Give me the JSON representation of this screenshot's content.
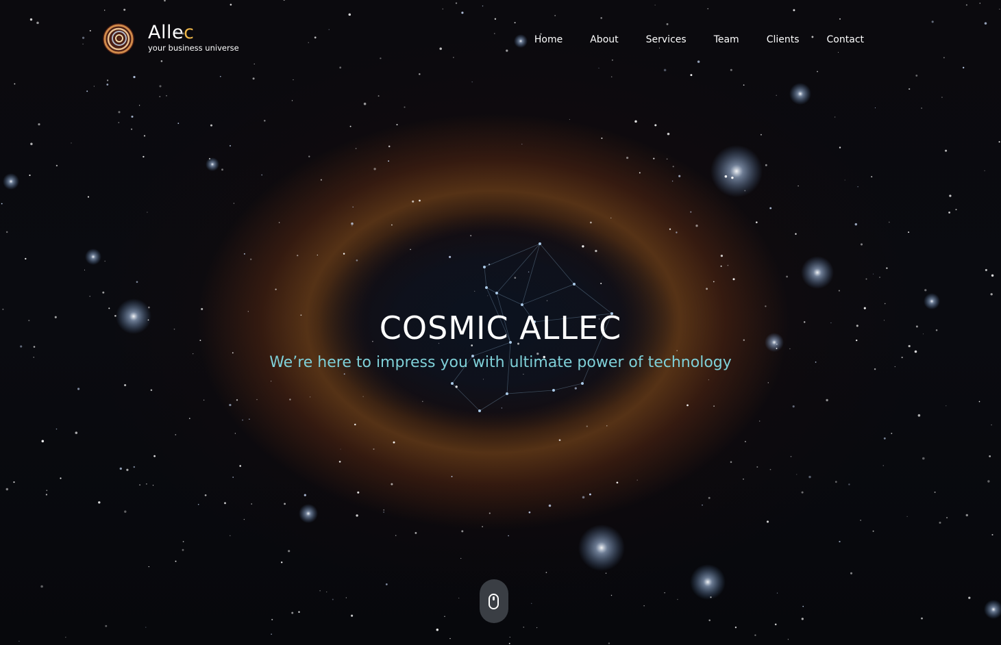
{
  "brand": {
    "name_main": "Alle",
    "name_accent": "c",
    "tagline": "your business universe",
    "accent_color": "#f0b84a"
  },
  "nav": {
    "items": [
      {
        "label": "Home"
      },
      {
        "label": "About"
      },
      {
        "label": "Services"
      },
      {
        "label": "Team"
      },
      {
        "label": "Clients"
      },
      {
        "label": "Contact"
      }
    ]
  },
  "hero": {
    "title": "COSMIC ALLEC",
    "subtitle": "We’re here to impress you with ultimate power of technology",
    "subtitle_color": "#7fd0d8"
  },
  "scroll_indicator": {
    "icon": "mouse-scroll-icon"
  }
}
